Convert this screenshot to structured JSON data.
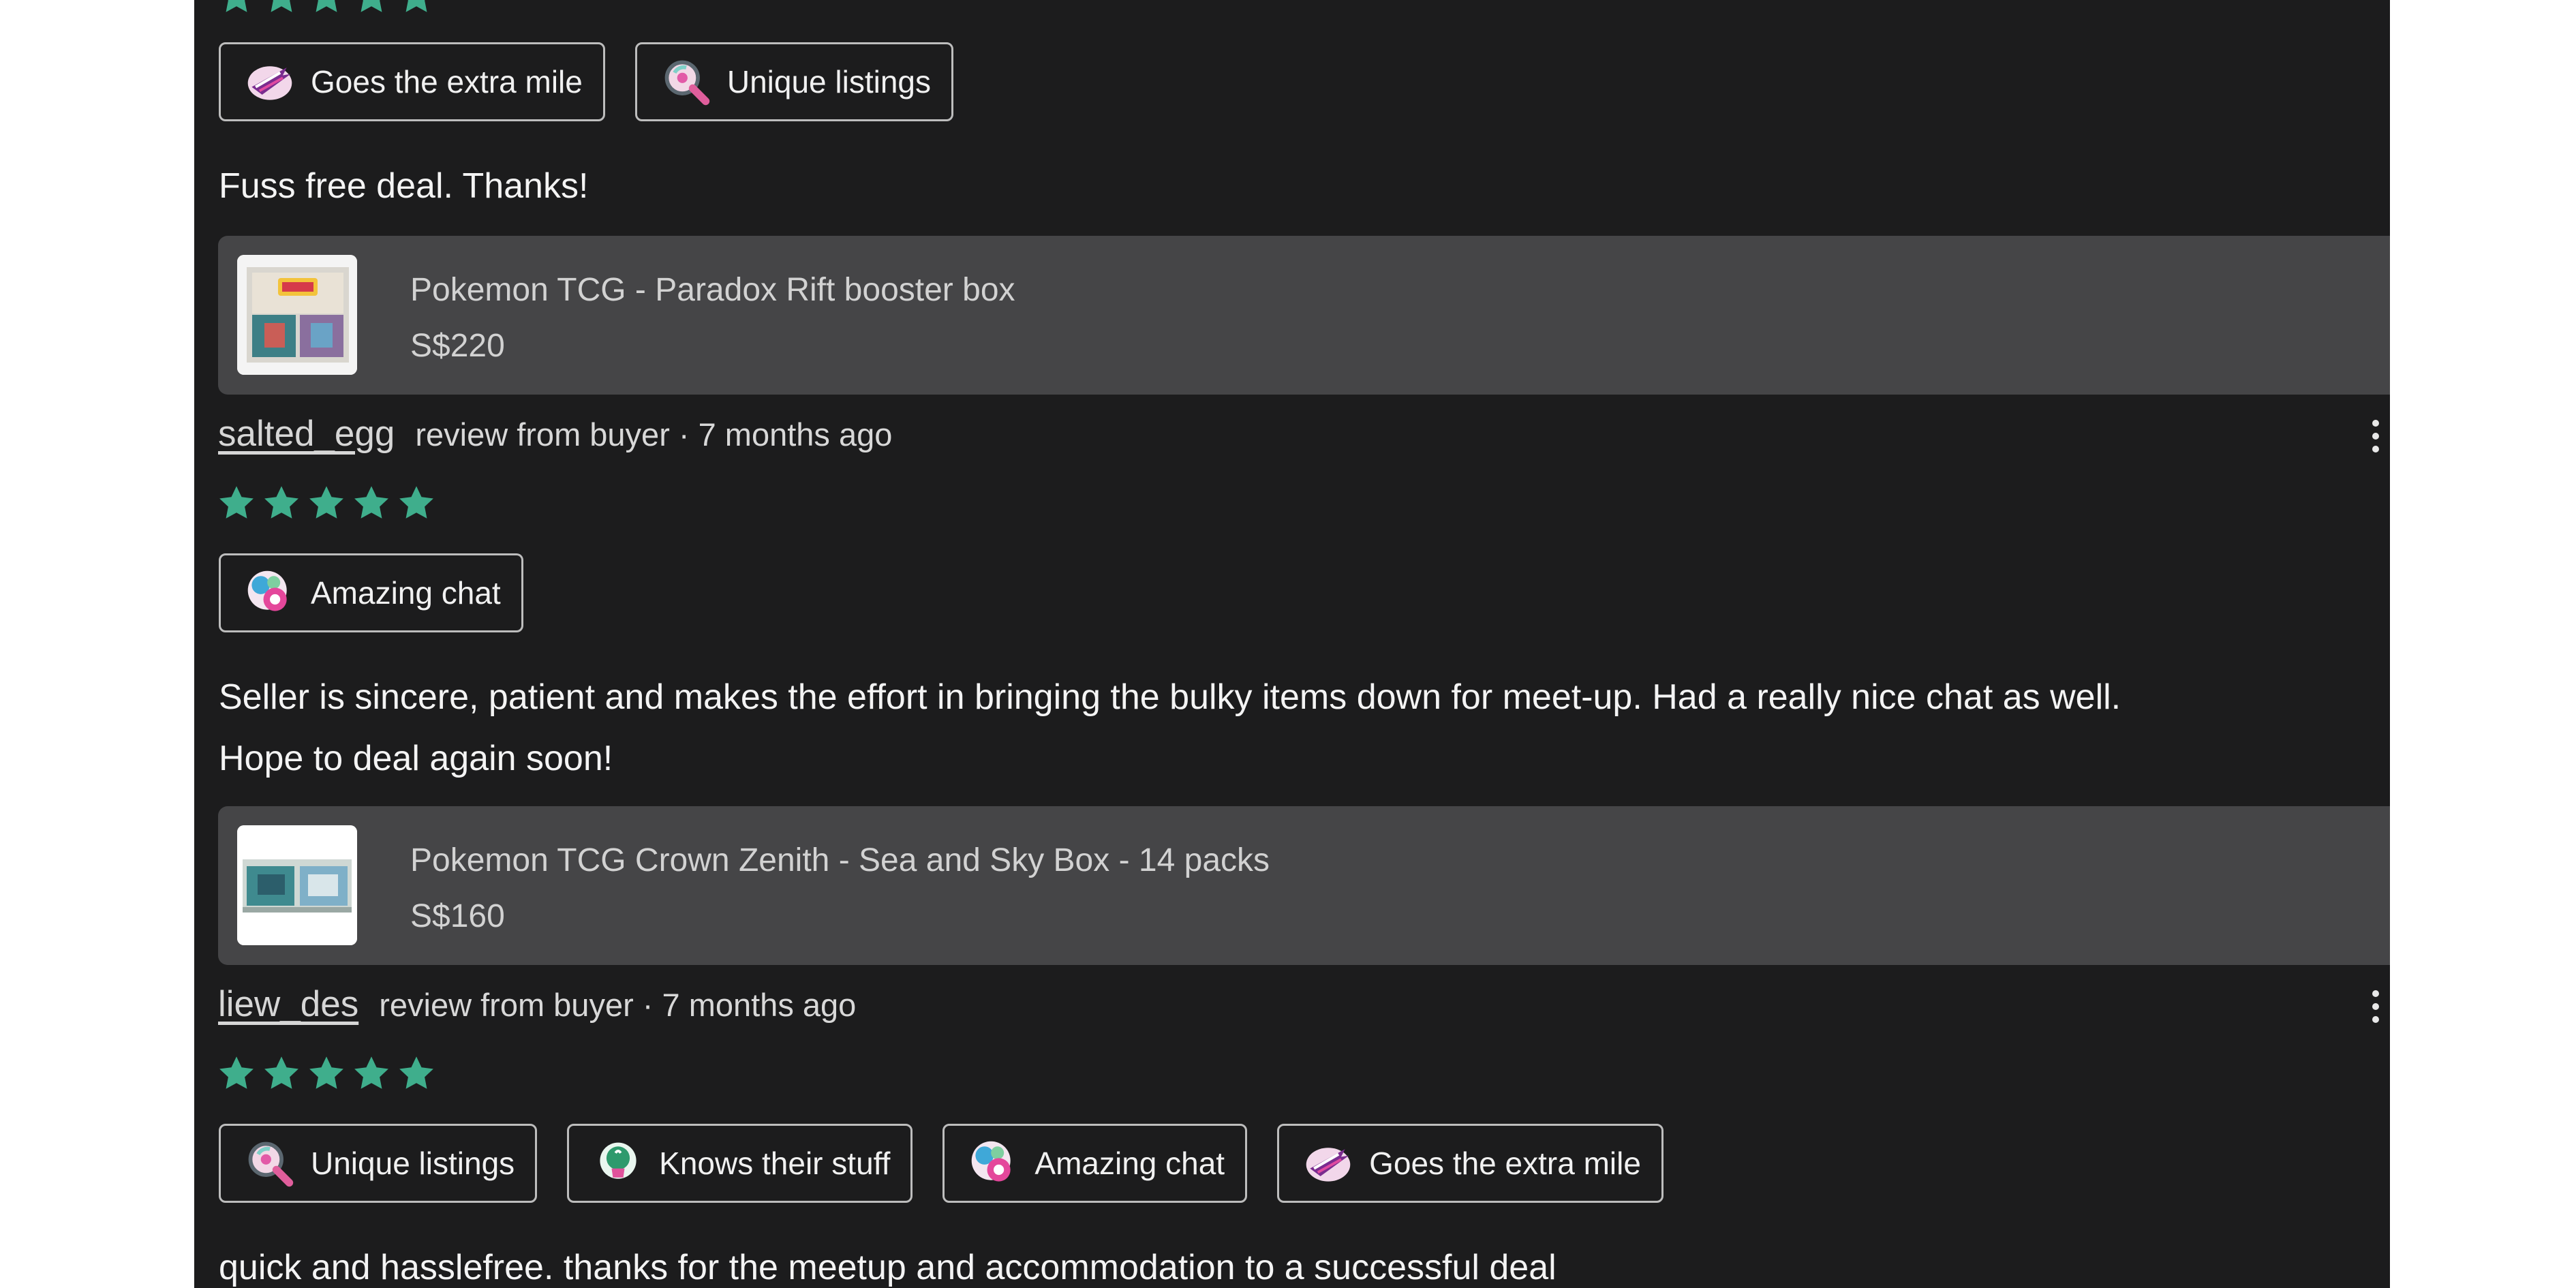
{
  "colors": {
    "background": "#1c1c1d",
    "star": "#3fae8c",
    "listing_card": "#454547",
    "tag_border": "#bdbdbd"
  },
  "top_review": {
    "rating": 5,
    "tags": [
      {
        "label": "Goes the extra mile",
        "icon": "extra-mile-icon"
      },
      {
        "label": "Unique listings",
        "icon": "unique-listings-icon"
      }
    ],
    "text": "Fuss free deal. Thanks!",
    "listing": {
      "title": "Pokemon TCG - Paradox Rift booster box",
      "price": "S$220"
    }
  },
  "review_1": {
    "username": "salted_egg",
    "meta": "review from buyer · 7 months ago",
    "rating": 5,
    "tags": [
      {
        "label": "Amazing chat",
        "icon": "amazing-chat-icon"
      }
    ],
    "text_line1": "Seller is sincere, patient and makes the effort in bringing the bulky items down for meet-up. Had a really nice chat as well.",
    "text_line2": "Hope to deal again soon!",
    "listing": {
      "title": "Pokemon TCG Crown Zenith - Sea and Sky Box - 14 packs",
      "price": "S$160"
    }
  },
  "review_2": {
    "username": "liew_des",
    "meta": "review from buyer · 7 months ago",
    "rating": 5,
    "tags": [
      {
        "label": "Unique listings",
        "icon": "unique-listings-icon"
      },
      {
        "label": "Knows their stuff",
        "icon": "knows-their-stuff-icon"
      },
      {
        "label": "Amazing chat",
        "icon": "amazing-chat-icon"
      },
      {
        "label": "Goes the extra mile",
        "icon": "extra-mile-icon"
      }
    ],
    "text": "quick and hasslefree. thanks for the meetup and accommodation to a successful deal"
  }
}
